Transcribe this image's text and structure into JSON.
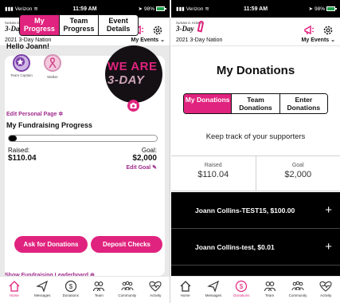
{
  "status_bar": {
    "carrier": "Verizon",
    "time": "11:59 AM",
    "battery": "98%"
  },
  "header": {
    "logo_top": "SUSAN G. KOMEN",
    "logo_main": "3-Day",
    "event_name": "2021 3-Day Nation",
    "events_menu": "My Events"
  },
  "progress_screen": {
    "tabs": [
      {
        "label": "My Progress",
        "active": true
      },
      {
        "label": "Team Progress",
        "active": false
      },
      {
        "label": "Event Details",
        "active": false
      }
    ],
    "greeting": "Hello Joann!",
    "badges": [
      {
        "label": "Team Captain",
        "icon": "star-icon"
      },
      {
        "label": "Walker",
        "icon": "walker-ribbon-icon"
      }
    ],
    "avatar_text_line1": "WE ARE",
    "avatar_text_line2": "3-DAY",
    "edit_personal_page": "Edit Personal Page",
    "fundraising_title": "My Fundraising Progress",
    "progress_fraction": 0.055,
    "raised_label": "Raised:",
    "raised_value": "$110.04",
    "goal_label": "Goal:",
    "goal_value": "$2,000",
    "edit_goal": "Edit Goal",
    "ask_button": "Ask for Donations",
    "deposit_button": "Deposit Checks",
    "leaderboard_link": "Show Fundraising Leaderboard"
  },
  "donations_screen": {
    "title": "My Donations",
    "tabs": [
      {
        "label": "My Donations",
        "active": true
      },
      {
        "label": "Team Donations",
        "active": false
      },
      {
        "label": "Enter Donations",
        "active": false
      }
    ],
    "subtitle": "Keep track of your supporters",
    "raised_label": "Raised",
    "raised_value": "$110.04",
    "goal_label": "Goal",
    "goal_value": "$2,000",
    "donations": [
      "Joann Collins-TEST15, $100.00",
      "Joann Collins-test, $0.01"
    ]
  },
  "bottom_nav": [
    {
      "label": "Home",
      "icon": "home-icon"
    },
    {
      "label": "Messages",
      "icon": "send-icon"
    },
    {
      "label": "Donations",
      "icon": "dollar-icon"
    },
    {
      "label": "Team",
      "icon": "team-icon"
    },
    {
      "label": "Community",
      "icon": "community-icon"
    },
    {
      "label": "Activity",
      "icon": "heart-pulse-icon"
    }
  ],
  "colors": {
    "accent": "#e0237e",
    "link": "#a02b8c",
    "list_background": "#000000"
  }
}
